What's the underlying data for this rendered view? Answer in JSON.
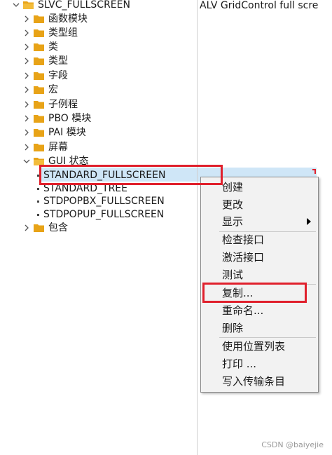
{
  "tree": {
    "root": {
      "label": "SLVC_FULLSCREEN"
    },
    "nodes": [
      {
        "label": "函数模块"
      },
      {
        "label": "类型组"
      },
      {
        "label": "类"
      },
      {
        "label": "类型"
      },
      {
        "label": "字段"
      },
      {
        "label": "宏"
      },
      {
        "label": "子例程"
      },
      {
        "label": "PBO 模块"
      },
      {
        "label": "PAI 模块"
      },
      {
        "label": "屏幕"
      },
      {
        "label": "GUI 状态"
      }
    ],
    "gui_children": [
      {
        "label": "STANDARD_FULLSCREEN"
      },
      {
        "label": "STANDARD_TREE"
      },
      {
        "label": "STDPOPBX_FULLSCREEN"
      },
      {
        "label": "STDPOPUP_FULLSCREEN"
      }
    ],
    "last_node": {
      "label": "包含"
    }
  },
  "description": {
    "text": "ALV GridControl full scre"
  },
  "context_menu": {
    "items": [
      {
        "label": "创建"
      },
      {
        "label": "更改"
      },
      {
        "label": "显示"
      },
      {
        "label": "检查接口"
      },
      {
        "label": "激活接口"
      },
      {
        "label": "测试"
      },
      {
        "label": "复制..."
      },
      {
        "label": "重命名..."
      },
      {
        "label": "删除"
      },
      {
        "label": "使用位置列表"
      },
      {
        "label": "打印 ..."
      },
      {
        "label": "写入传输条目"
      }
    ]
  },
  "watermark": "CSDN @baiyejie",
  "colors": {
    "folder": "#e8a317",
    "selection": "#cfe6f7",
    "highlight_box": "#e0202c",
    "menu_bg": "#f2f2f2"
  },
  "icons": {
    "expand": "chevron-right-icon",
    "collapse": "chevron-down-icon",
    "folder": "folder-icon",
    "folder_open": "folder-open-icon",
    "submenu": "triangle-right-icon"
  }
}
